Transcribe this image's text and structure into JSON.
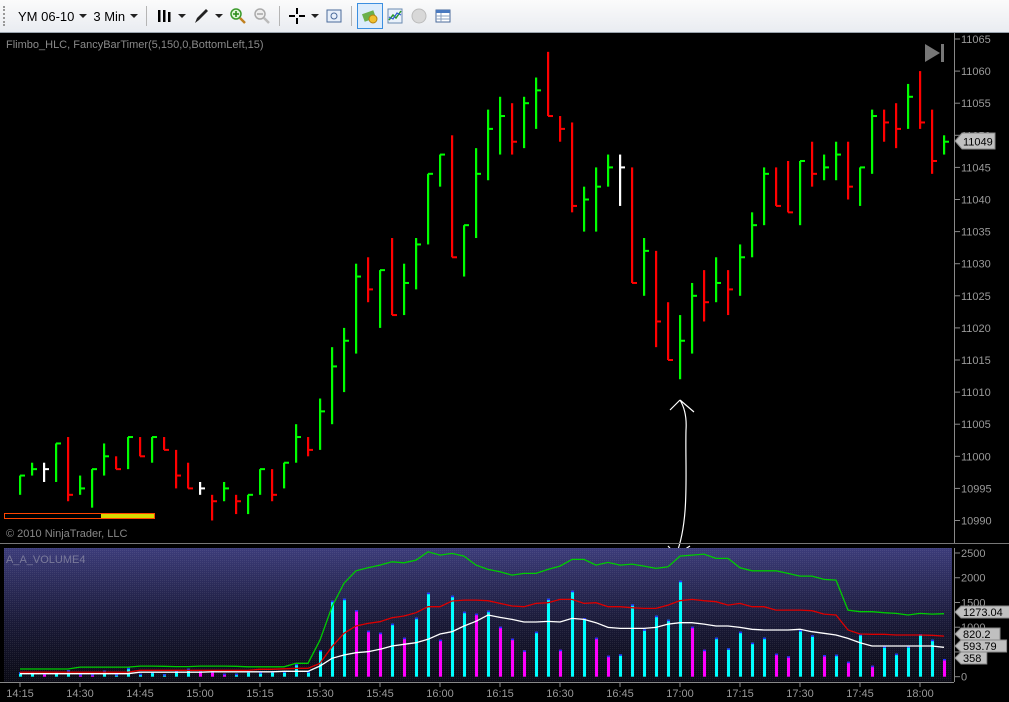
{
  "toolbar": {
    "instrument": "YM 06-10",
    "interval": "3 Min",
    "icons": [
      "bar-type-icon",
      "pencil-icon",
      "zoom-in-icon",
      "zoom-out-icon",
      "crosshair-icon",
      "properties-icon",
      "strategy-icon",
      "indicator-icon",
      "currency-icon",
      "data-box-icon"
    ]
  },
  "price_panel": {
    "indicator_label": "Flimbo_HLC, FancyBarTimer(5,150,0,BottomLeft,15)",
    "copyright": "© 2010 NinjaTrader, LLC",
    "last_price_label": "11049",
    "axis_labels": [
      "11065",
      "11060",
      "11055",
      "11050",
      "11045",
      "11040",
      "11035",
      "11030",
      "11025",
      "11020",
      "11015",
      "11010",
      "11005",
      "11000",
      "10995",
      "10990"
    ],
    "timer_progress": 0.36,
    "colors": {
      "up": "#00ff00",
      "down": "#ff0000",
      "neutral": "#ffffff"
    }
  },
  "volume_panel": {
    "title": "A_A_VOLUME4",
    "axis_labels": [
      "2500",
      "2000",
      "1500",
      "1000",
      "500",
      "0"
    ],
    "value_labels": [
      "1273.04",
      "820.2",
      "593.79",
      "358"
    ],
    "colors": {
      "up": "#00ffff",
      "down": "#ff00ff",
      "fast": "#00cc00",
      "mid": "#dd0000",
      "slow": "#ffffff"
    }
  },
  "time_axis": [
    "14:15",
    "14:30",
    "14:45",
    "15:00",
    "15:15",
    "15:30",
    "15:45",
    "16:00",
    "16:15",
    "16:30",
    "16:45",
    "17:00",
    "17:15",
    "17:30",
    "17:45",
    "18:00"
  ],
  "chart_data": {
    "type": "ohlc",
    "interval_minutes": 3,
    "start_time": "14:15",
    "ylim": [
      10990,
      11065
    ],
    "bars": [
      [
        10997,
        10994,
        10997,
        "g"
      ],
      [
        10999,
        10997,
        10998,
        "g"
      ],
      [
        10999,
        10996,
        10998,
        "w"
      ],
      [
        11002,
        10996,
        11002,
        "g"
      ],
      [
        11003,
        10993,
        10994,
        "r"
      ],
      [
        10997,
        10994,
        10995,
        "g"
      ],
      [
        10998,
        10992,
        10998,
        "g"
      ],
      [
        11002,
        10997,
        11000,
        "g"
      ],
      [
        11000,
        10998,
        10998,
        "r"
      ],
      [
        11003,
        10998,
        11003,
        "g"
      ],
      [
        11003,
        11000,
        11000,
        "r"
      ],
      [
        11003,
        10999,
        11003,
        "g"
      ],
      [
        11003,
        11001,
        11001,
        "r"
      ],
      [
        11001,
        10995,
        10997,
        "r"
      ],
      [
        10999,
        10995,
        10995,
        "r"
      ],
      [
        10996,
        10994,
        10995,
        "w"
      ],
      [
        10994,
        10990,
        10993,
        "r"
      ],
      [
        10996,
        10993,
        10995,
        "g"
      ],
      [
        10994,
        10991,
        10993,
        "r"
      ],
      [
        10994,
        10991,
        10994,
        "g"
      ],
      [
        10998,
        10994,
        10998,
        "g"
      ],
      [
        10998,
        10993,
        10994,
        "r"
      ],
      [
        10999,
        10995,
        10999,
        "g"
      ],
      [
        11005,
        10999,
        11003,
        "g"
      ],
      [
        11003,
        11000,
        11001,
        "r"
      ],
      [
        11009,
        11001,
        11007,
        "g"
      ],
      [
        11017,
        11005,
        11014,
        "g"
      ],
      [
        11020,
        11010,
        11018,
        "g"
      ],
      [
        11030,
        11016,
        11028,
        "g"
      ],
      [
        11031,
        11024,
        11026,
        "r"
      ],
      [
        11029,
        11020,
        11029,
        "g"
      ],
      [
        11034,
        11022,
        11022,
        "r"
      ],
      [
        11030,
        11022,
        11027,
        "g"
      ],
      [
        11034,
        11026,
        11033,
        "g"
      ],
      [
        11044,
        11033,
        11044,
        "g"
      ],
      [
        11047,
        11042,
        11047,
        "g"
      ],
      [
        11050,
        11031,
        11031,
        "r"
      ],
      [
        11036,
        11028,
        11036,
        "g"
      ],
      [
        11048,
        11034,
        11044,
        "g"
      ],
      [
        11054,
        11043,
        11051,
        "g"
      ],
      [
        11056,
        11047,
        11053,
        "g"
      ],
      [
        11055,
        11047,
        11049,
        "r"
      ],
      [
        11056,
        11048,
        11055,
        "g"
      ],
      [
        11059,
        11051,
        11057,
        "g"
      ],
      [
        11063,
        11053,
        11053,
        "r"
      ],
      [
        11053,
        11049,
        11051,
        "r"
      ],
      [
        11052,
        11038,
        11039,
        "r"
      ],
      [
        11042,
        11035,
        11040,
        "g"
      ],
      [
        11045,
        11035,
        11042,
        "g"
      ],
      [
        11047,
        11042,
        11045,
        "g"
      ],
      [
        11047,
        11039,
        11045,
        "w"
      ],
      [
        11045,
        11027,
        11027,
        "r"
      ],
      [
        11034,
        11025,
        11032,
        "g"
      ],
      [
        11032,
        11017,
        11021,
        "r"
      ],
      [
        11024,
        11015,
        11015,
        "r"
      ],
      [
        11022,
        11012,
        11018,
        "g"
      ],
      [
        11027,
        11016,
        11025,
        "g"
      ],
      [
        11029,
        11021,
        11024,
        "r"
      ],
      [
        11031,
        11024,
        11027,
        "g"
      ],
      [
        11029,
        11022,
        11026,
        "r"
      ],
      [
        11033,
        11025,
        11031,
        "g"
      ],
      [
        11038,
        11031,
        11036,
        "g"
      ],
      [
        11045,
        11036,
        11044,
        "g"
      ],
      [
        11045,
        11039,
        11039,
        "r"
      ],
      [
        11046,
        11038,
        11038,
        "r"
      ],
      [
        11046,
        11036,
        11046,
        "g"
      ],
      [
        11049,
        11042,
        11044,
        "r"
      ],
      [
        11047,
        11043,
        11045,
        "g"
      ],
      [
        11049,
        11043,
        11047,
        "g"
      ],
      [
        11049,
        11040,
        11042,
        "r"
      ],
      [
        11045,
        11039,
        11045,
        "g"
      ],
      [
        11054,
        11044,
        11053,
        "g"
      ],
      [
        11054,
        11049,
        11052,
        "r"
      ],
      [
        11055,
        11048,
        11051,
        "r"
      ],
      [
        11058,
        11051,
        11056,
        "g"
      ],
      [
        11060,
        11051,
        11052,
        "r"
      ],
      [
        11054,
        11044,
        11046,
        "r"
      ],
      [
        11050,
        11047,
        11049,
        "g"
      ]
    ],
    "volume_ylim": [
      0,
      2500
    ],
    "volume": [
      [
        90,
        "c"
      ],
      [
        90,
        "c"
      ],
      [
        70,
        "m"
      ],
      [
        90,
        "c"
      ],
      [
        130,
        "c"
      ],
      [
        50,
        "m"
      ],
      [
        50,
        "m"
      ],
      [
        120,
        "c"
      ],
      [
        50,
        "c"
      ],
      [
        180,
        "c"
      ],
      [
        60,
        "c"
      ],
      [
        100,
        "c"
      ],
      [
        50,
        "c"
      ],
      [
        130,
        "c"
      ],
      [
        160,
        "c"
      ],
      [
        110,
        "m"
      ],
      [
        110,
        "m"
      ],
      [
        60,
        "m"
      ],
      [
        60,
        "c"
      ],
      [
        110,
        "c"
      ],
      [
        90,
        "c"
      ],
      [
        110,
        "c"
      ],
      [
        110,
        "c"
      ],
      [
        260,
        "c"
      ],
      [
        110,
        "c"
      ],
      [
        540,
        "c"
      ],
      [
        1535,
        "c"
      ],
      [
        1576,
        "c"
      ],
      [
        1347,
        "m"
      ],
      [
        929,
        "m"
      ],
      [
        889,
        "m"
      ],
      [
        1071,
        "c"
      ],
      [
        788,
        "m"
      ],
      [
        1192,
        "c"
      ],
      [
        1697,
        "c"
      ],
      [
        747,
        "m"
      ],
      [
        1636,
        "c"
      ],
      [
        1313,
        "c"
      ],
      [
        1273,
        "m"
      ],
      [
        1333,
        "c"
      ],
      [
        1010,
        "m"
      ],
      [
        768,
        "m"
      ],
      [
        533,
        "m"
      ],
      [
        909,
        "c"
      ],
      [
        1576,
        "c"
      ],
      [
        545,
        "m"
      ],
      [
        1737,
        "c"
      ],
      [
        1186,
        "c"
      ],
      [
        788,
        "m"
      ],
      [
        424,
        "m"
      ],
      [
        452,
        "c"
      ],
      [
        1462,
        "c"
      ],
      [
        957,
        "c"
      ],
      [
        1232,
        "c"
      ],
      [
        1151,
        "c"
      ],
      [
        1939,
        "c"
      ],
      [
        1010,
        "m"
      ],
      [
        545,
        "m"
      ],
      [
        788,
        "c"
      ],
      [
        573,
        "c"
      ],
      [
        909,
        "c"
      ],
      [
        687,
        "c"
      ],
      [
        788,
        "c"
      ],
      [
        465,
        "m"
      ],
      [
        412,
        "m"
      ],
      [
        943,
        "c"
      ],
      [
        836,
        "c"
      ],
      [
        438,
        "m"
      ],
      [
        444,
        "c"
      ],
      [
        303,
        "m"
      ],
      [
        863,
        "c"
      ],
      [
        222,
        "m"
      ],
      [
        614,
        "c"
      ],
      [
        465,
        "c"
      ],
      [
        620,
        "c"
      ],
      [
        863,
        "c"
      ],
      [
        747,
        "c"
      ],
      [
        358,
        "m"
      ]
    ],
    "line_fast": [
      155,
      155,
      155,
      155,
      155,
      195,
      195,
      195,
      195,
      195,
      215,
      215,
      210,
      205,
      205,
      215,
      215,
      215,
      210,
      200,
      200,
      200,
      200,
      270,
      270,
      740,
      1414,
      1890,
      2141,
      2200,
      2256,
      2323,
      2302,
      2357,
      2525,
      2458,
      2492,
      2438,
      2256,
      2169,
      2121,
      2054,
      2088,
      2088,
      2169,
      2236,
      2371,
      2371,
      2256,
      2310,
      2256,
      2276,
      2236,
      2189,
      2222,
      2438,
      2458,
      2478,
      2391,
      2391,
      2200,
      2141,
      2141,
      2141,
      2088,
      2034,
      2034,
      1967,
      1953,
      1347,
      1313,
      1313,
      1293,
      1280,
      1246,
      1280,
      1266,
      1273
    ],
    "line_mid": [
      90,
      90,
      90,
      90,
      90,
      90,
      90,
      90,
      90,
      90,
      130,
      130,
      130,
      130,
      130,
      130,
      130,
      130,
      130,
      130,
      150,
      150,
      160,
      170,
      170,
      270,
      606,
      877,
      1024,
      1078,
      1111,
      1192,
      1226,
      1293,
      1414,
      1414,
      1529,
      1549,
      1549,
      1536,
      1482,
      1428,
      1414,
      1482,
      1496,
      1563,
      1563,
      1482,
      1496,
      1414,
      1414,
      1394,
      1380,
      1380,
      1448,
      1536,
      1563,
      1536,
      1516,
      1448,
      1482,
      1414,
      1414,
      1347,
      1347,
      1347,
      1334,
      1266,
      1246,
      943,
      863,
      856,
      856,
      842,
      842,
      842,
      836,
      820
    ],
    "line_slow": [
      60,
      60,
      60,
      60,
      60,
      60,
      60,
      60,
      60,
      60,
      90,
      90,
      90,
      90,
      90,
      90,
      100,
      100,
      100,
      100,
      100,
      100,
      110,
      110,
      110,
      216,
      372,
      438,
      485,
      505,
      553,
      620,
      654,
      687,
      755,
      863,
      909,
      1024,
      1120,
      1246,
      1199,
      1159,
      1105,
      1105,
      1118,
      1105,
      1179,
      1159,
      1091,
      997,
      977,
      977,
      977,
      997,
      1064,
      1091,
      1091,
      1064,
      1024,
      1024,
      997,
      957,
      943,
      943,
      943,
      957,
      909,
      877,
      842,
      775,
      687,
      620,
      620,
      620,
      620,
      620,
      620,
      594
    ]
  }
}
